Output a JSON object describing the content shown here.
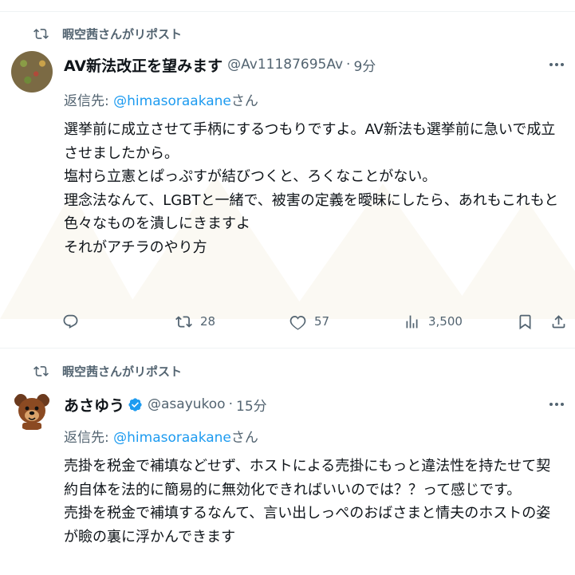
{
  "tweets": [
    {
      "repost_label": "暇空茜さんがリポスト",
      "name": "AV新法改正を望みます",
      "handle": "@Av11187695Av",
      "sep": "·",
      "time": "9分",
      "reply_prefix": "返信先: ",
      "reply_mention": "@himasoraakane",
      "reply_suffix": "さん",
      "lines": [
        "選挙前に成立させて手柄にするつもりですよ。AV新法も選挙前に急いで成立",
        "させましたから。",
        "塩村ら立憲とぱっぷすが結びつくと、ろくなことがない。",
        "理念法なんて、LGBTと一緒で、被害の定義を曖昧にしたら、あれもこれもと",
        "色々なものを潰しにきますよ",
        "それがアチラのやり方"
      ],
      "actions": {
        "reposts": "28",
        "likes": "57",
        "views": "3,500"
      }
    },
    {
      "repost_label": "暇空茜さんがリポスト",
      "name": "あさゆう",
      "verified": true,
      "handle": "@asayukoo",
      "sep": "·",
      "time": "15分",
      "reply_prefix": "返信先: ",
      "reply_mention": "@himasoraakane",
      "reply_suffix": "さん",
      "lines": [
        "売掛を税金で補填などせず、ホストによる売掛にもっと違法性を持たせて契",
        "約自体を法的に簡易的に無効化できればいいのでは？？って感じです。",
        "売掛を税金で補填するなんて、言い出しっぺのおばさまと情夫のホストの姿",
        "が瞼の裏に浮かんできます"
      ]
    }
  ],
  "icons": {
    "repost": "repost-icon",
    "reply": "reply-icon",
    "like": "heart-icon",
    "views": "views-icon",
    "bookmark": "bookmark-icon",
    "share": "share-icon",
    "verified": "verified-badge-icon",
    "more": "more-icon"
  },
  "colors": {
    "accent": "#1d9bf0",
    "text": "#0f1419",
    "secondary": "#536471"
  }
}
